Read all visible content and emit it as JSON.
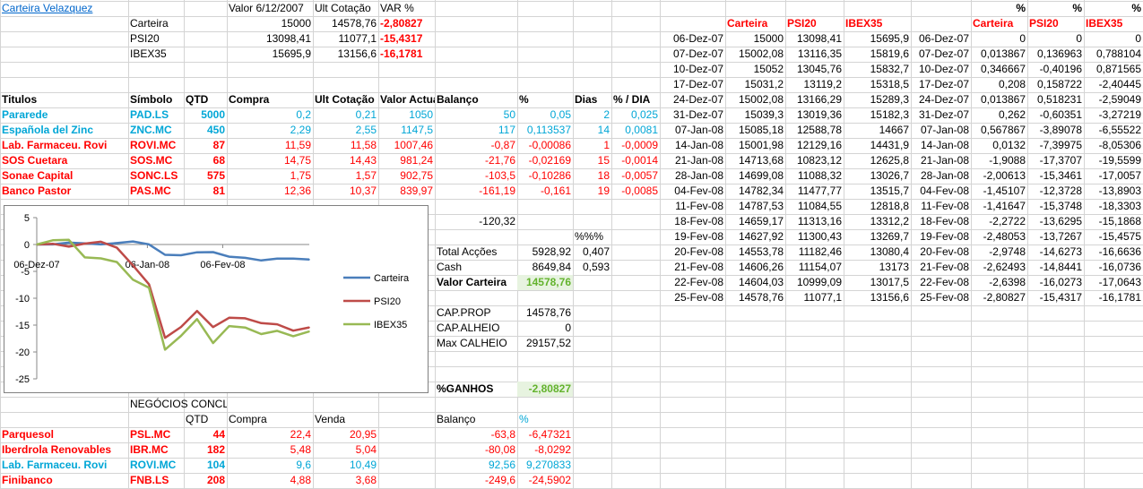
{
  "title": "Carteira Velazquez",
  "summary": {
    "headers": [
      "Valor 6/12/2007",
      "Ult Cotação",
      "VAR %"
    ],
    "rows": [
      {
        "label": "Carteira",
        "v1": "15000",
        "v2": "14578,76",
        "v3": "-2,80827"
      },
      {
        "label": "PSI20",
        "v1": "13098,41",
        "v2": "11077,1",
        "v3": "-15,4317"
      },
      {
        "label": "IBEX35",
        "v1": "15695,9",
        "v2": "13156,6",
        "v3": "-16,1781"
      }
    ]
  },
  "holdings": {
    "headers": [
      "Titulos",
      "Símbolo",
      "QTD",
      "Compra",
      "Ult Cotação",
      "Valor Actual",
      "Balanço",
      "%",
      "Dias",
      "% / DIA"
    ],
    "rows": [
      {
        "name": "Pararede",
        "sym": "PAD.LS",
        "qtd": "5000",
        "compra": "0,2",
        "ult": "0,21",
        "valor": "1050",
        "bal": "50",
        "pct": "0,05",
        "dias": "2",
        "pd": "0,025",
        "color": "blue"
      },
      {
        "name": "Española del Zinc",
        "sym": "ZNC.MC",
        "qtd": "450",
        "compra": "2,29",
        "ult": "2,55",
        "valor": "1147,5",
        "bal": "117",
        "pct": "0,113537",
        "dias": "14",
        "pd": "0,0081",
        "color": "blue"
      },
      {
        "name": "Lab. Farmaceu. Rovi",
        "sym": "ROVI.MC",
        "qtd": "87",
        "compra": "11,59",
        "ult": "11,58",
        "valor": "1007,46",
        "bal": "-0,87",
        "pct": "-0,00086",
        "dias": "1",
        "pd": "-0,0009",
        "color": "red"
      },
      {
        "name": "SOS Cuetara",
        "sym": "SOS.MC",
        "qtd": "68",
        "compra": "14,75",
        "ult": "14,43",
        "valor": "981,24",
        "bal": "-21,76",
        "pct": "-0,02169",
        "dias": "15",
        "pd": "-0,0014",
        "color": "red"
      },
      {
        "name": "Sonae Capital",
        "sym": "SONC.LS",
        "qtd": "575",
        "compra": "1,75",
        "ult": "1,57",
        "valor": "902,75",
        "bal": "-103,5",
        "pct": "-0,10286",
        "dias": "18",
        "pd": "-0,0057",
        "color": "red"
      },
      {
        "name": "Banco Pastor",
        "sym": "PAS.MC",
        "qtd": "81",
        "compra": "12,36",
        "ult": "10,37",
        "valor": "839,97",
        "bal": "-161,19",
        "pct": "-0,161",
        "dias": "19",
        "pd": "-0,0085",
        "color": "red"
      }
    ]
  },
  "totals": {
    "balanco_total": "-120,32",
    "pct_header": "%%%",
    "total_accoes_label": "Total Acções",
    "total_accoes": "5928,92",
    "total_accoes_pct": "0,407",
    "cash_label": "Cash",
    "cash": "8649,84",
    "cash_pct": "0,593",
    "valor_carteira_label": "Valor Carteira",
    "valor_carteira": "14578,76",
    "cap_prop_label": "CAP.PROP",
    "cap_prop": "14578,76",
    "cap_alheio_label": "CAP.ALHEIO",
    "cap_alheio": "0",
    "max_calheio_label": "Max CALHEIO",
    "max_calheio": "29157,52",
    "ganhos_label": "%GANHOS",
    "ganhos": "-2,80827"
  },
  "closed": {
    "title": "NEGÓCIOS CONCLUÍDOS",
    "headers": [
      "QTD",
      "Compra",
      "Venda",
      "Balanço",
      "%"
    ],
    "rows": [
      {
        "name": "Parquesol",
        "sym": "PSL.MC",
        "qtd": "44",
        "compra": "22,4",
        "venda": "20,95",
        "bal": "-63,8",
        "pct": "-6,47321",
        "color": "red"
      },
      {
        "name": "Iberdrola Renovables",
        "sym": "IBR.MC",
        "qtd": "182",
        "compra": "5,48",
        "venda": "5,04",
        "bal": "-80,08",
        "pct": "-8,0292",
        "color": "red"
      },
      {
        "name": "Lab. Farmaceu. Rovi",
        "sym": "ROVI.MC",
        "qtd": "104",
        "compra": "9,6",
        "venda": "10,49",
        "bal": "92,56",
        "pct": "9,270833",
        "color": "blue"
      },
      {
        "name": "Finibanco",
        "sym": "FNB.LS",
        "qtd": "208",
        "compra": "4,88",
        "venda": "3,68",
        "bal": "-249,6",
        "pct": "-24,5902",
        "color": "red"
      }
    ]
  },
  "history": {
    "headers": [
      "Carteira",
      "PSI20",
      "IBEX35"
    ],
    "pct_label": "%",
    "pct_headers": [
      "Carteira",
      "PSI20",
      "IBEX35"
    ],
    "rows": [
      [
        "06-Dez-07",
        "15000",
        "13098,41",
        "15695,9",
        "06-Dez-07",
        "0",
        "0",
        "0"
      ],
      [
        "07-Dez-07",
        "15002,08",
        "13116,35",
        "15819,6",
        "07-Dez-07",
        "0,013867",
        "0,136963",
        "0,788104"
      ],
      [
        "10-Dez-07",
        "15052",
        "13045,76",
        "15832,7",
        "10-Dez-07",
        "0,346667",
        "-0,40196",
        "0,871565"
      ],
      [
        "17-Dez-07",
        "15031,2",
        "13119,2",
        "15318,5",
        "17-Dez-07",
        "0,208",
        "0,158722",
        "-2,40445"
      ],
      [
        "24-Dez-07",
        "15002,08",
        "13166,29",
        "15289,3",
        "24-Dez-07",
        "0,013867",
        "0,518231",
        "-2,59049"
      ],
      [
        "31-Dez-07",
        "15039,3",
        "13019,36",
        "15182,3",
        "31-Dez-07",
        "0,262",
        "-0,60351",
        "-3,27219"
      ],
      [
        "07-Jan-08",
        "15085,18",
        "12588,78",
        "14667",
        "07-Jan-08",
        "0,567867",
        "-3,89078",
        "-6,55522"
      ],
      [
        "14-Jan-08",
        "15001,98",
        "12129,16",
        "14431,9",
        "14-Jan-08",
        "0,0132",
        "-7,39975",
        "-8,05306"
      ],
      [
        "21-Jan-08",
        "14713,68",
        "10823,12",
        "12625,8",
        "21-Jan-08",
        "-1,9088",
        "-17,3707",
        "-19,5599"
      ],
      [
        "28-Jan-08",
        "14699,08",
        "11088,32",
        "13026,7",
        "28-Jan-08",
        "-2,00613",
        "-15,3461",
        "-17,0057"
      ],
      [
        "04-Fev-08",
        "14782,34",
        "11477,77",
        "13515,7",
        "04-Fev-08",
        "-1,45107",
        "-12,3728",
        "-13,8903"
      ],
      [
        "11-Fev-08",
        "14787,53",
        "11084,55",
        "12818,8",
        "11-Fev-08",
        "-1,41647",
        "-15,3748",
        "-18,3303"
      ],
      [
        "18-Fev-08",
        "14659,17",
        "11313,16",
        "13312,2",
        "18-Fev-08",
        "-2,2722",
        "-13,6295",
        "-15,1868"
      ],
      [
        "19-Fev-08",
        "14627,92",
        "11300,43",
        "13269,7",
        "19-Fev-08",
        "-2,48053",
        "-13,7267",
        "-15,4575"
      ],
      [
        "20-Fev-08",
        "14553,78",
        "11182,46",
        "13080,4",
        "20-Fev-08",
        "-2,9748",
        "-14,6273",
        "-16,6636"
      ],
      [
        "21-Fev-08",
        "14606,26",
        "11154,07",
        "13173",
        "21-Fev-08",
        "-2,62493",
        "-14,8441",
        "-16,0736"
      ],
      [
        "22-Fev-08",
        "14604,03",
        "10999,09",
        "13017,5",
        "22-Fev-08",
        "-2,6398",
        "-16,0273",
        "-17,0643"
      ],
      [
        "25-Fev-08",
        "14578,76",
        "11077,1",
        "13156,6",
        "25-Fev-08",
        "-2,80827",
        "-15,4317",
        "-16,1781"
      ]
    ]
  },
  "chart_data": {
    "type": "line",
    "x": [
      "06-Dez-07",
      "07-Dez-07",
      "10-Dez-07",
      "17-Dez-07",
      "24-Dez-07",
      "31-Dez-07",
      "07-Jan-08",
      "14-Jan-08",
      "21-Jan-08",
      "28-Jan-08",
      "04-Fev-08",
      "11-Fev-08",
      "18-Fev-08",
      "19-Fev-08",
      "20-Fev-08",
      "21-Fev-08",
      "22-Fev-08",
      "25-Fev-08"
    ],
    "x_tick_labels": [
      "06-Dez-07",
      "06-Jan-08",
      "06-Fev-08"
    ],
    "y_ticks": [
      5,
      0,
      -5,
      -10,
      -15,
      -20,
      -25
    ],
    "ylim": [
      -25,
      5
    ],
    "legend_position": "right",
    "series": [
      {
        "name": "Carteira",
        "color": "#4a7ebb",
        "values": [
          0,
          0.013867,
          0.346667,
          0.208,
          0.013867,
          0.262,
          0.567867,
          0.0132,
          -1.9088,
          -2.00613,
          -1.45107,
          -1.41647,
          -2.2722,
          -2.48053,
          -2.9748,
          -2.62493,
          -2.6398,
          -2.80827
        ]
      },
      {
        "name": "PSI20",
        "color": "#be4b48",
        "values": [
          0,
          0.136963,
          -0.40196,
          0.158722,
          0.518231,
          -0.60351,
          -3.89078,
          -7.39975,
          -17.3707,
          -15.3461,
          -12.3728,
          -15.3748,
          -13.6295,
          -13.7267,
          -14.6273,
          -14.8441,
          -16.0273,
          -15.4317
        ]
      },
      {
        "name": "IBEX35",
        "color": "#98b954",
        "values": [
          0,
          0.788104,
          0.871565,
          -2.40445,
          -2.59049,
          -3.27219,
          -6.55522,
          -8.05306,
          -19.5599,
          -17.0057,
          -13.8903,
          -18.3303,
          -15.1868,
          -15.4575,
          -16.6636,
          -16.0736,
          -17.0643,
          -16.1781
        ]
      }
    ]
  }
}
